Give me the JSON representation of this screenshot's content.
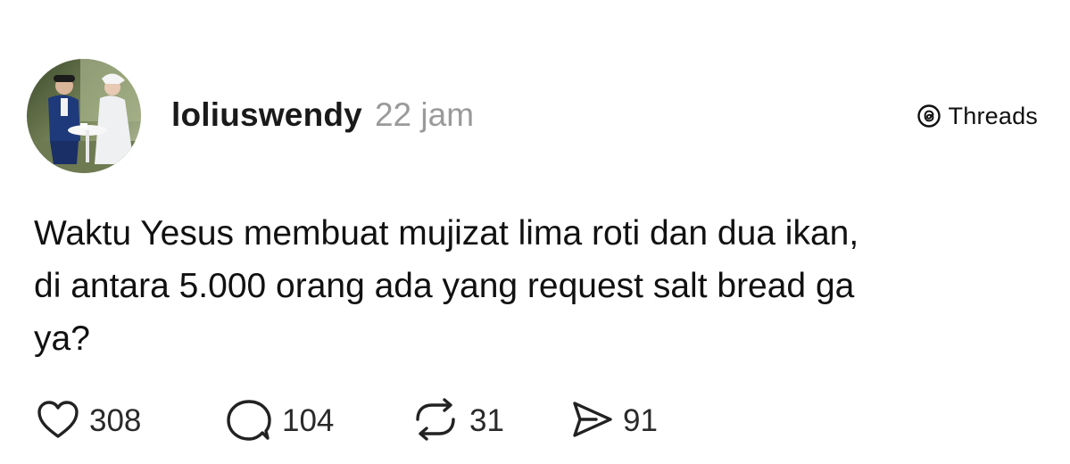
{
  "post": {
    "username": "loliuswendy",
    "time": "22 jam",
    "brand": {
      "label": "Threads",
      "icon": "threads-logo-icon"
    },
    "text_lines": [
      "Waktu Yesus membuat mujizat lima roti dan dua ikan,",
      "di antara 5.000 orang ada yang request salt bread ga",
      "ya?"
    ],
    "actions": {
      "likes": {
        "icon": "heart-icon",
        "count": "308"
      },
      "replies": {
        "icon": "comment-icon",
        "count": "104"
      },
      "reposts": {
        "icon": "repost-icon",
        "count": "31"
      },
      "shares": {
        "icon": "send-icon",
        "count": "91"
      }
    },
    "avatar": {
      "icon": "profile-photo"
    }
  },
  "colors": {
    "text": "#111111",
    "muted": "#9a9a9a",
    "background": "#ffffff"
  }
}
